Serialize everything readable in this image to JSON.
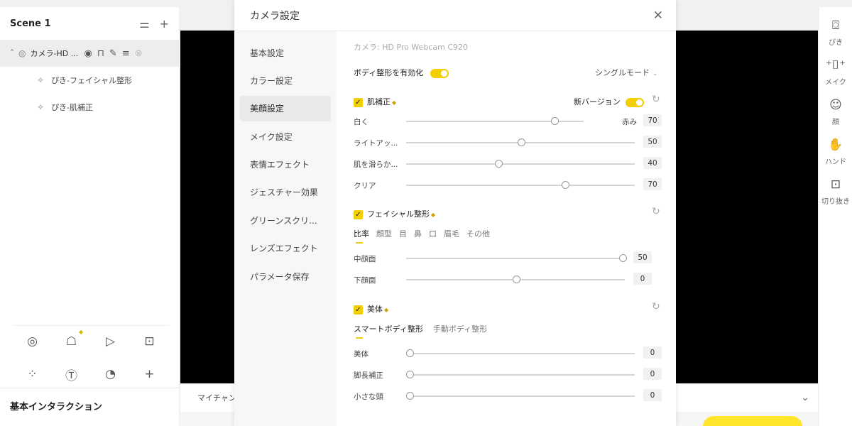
{
  "left": {
    "scene_title": "Scene 1",
    "source": {
      "name": "カメラ-HD ..."
    },
    "children": [
      "ぴき-フェイシャル整形",
      "ぴき-肌補正"
    ],
    "basic_interaction": "基本インタラクション"
  },
  "bottom_bar": {
    "label": "マイチャン"
  },
  "right_rail": [
    {
      "icon": "camera-frame-icon",
      "label": "ぴき"
    },
    {
      "icon": "makeup-icon",
      "label": "メイク"
    },
    {
      "icon": "face-icon",
      "label": "顔"
    },
    {
      "icon": "hand-icon",
      "label": "ハンド"
    },
    {
      "icon": "cutout-icon",
      "label": "切り抜き"
    }
  ],
  "modal": {
    "title": "カメラ設定",
    "nav": [
      "基本設定",
      "カラー設定",
      "美顔設定",
      "メイク設定",
      "表情エフェクト",
      "ジェスチャー効果",
      "グリーンスクリ...",
      "レンズエフェクト",
      "パラメータ保存"
    ],
    "active_nav": 2,
    "camera_label": "カメラ: HD Pro Webcam C920",
    "body_toggle_label": "ボディ整形を有効化",
    "mode_dropdown": "シングルモード",
    "skin": {
      "title": "肌補正",
      "new_version_label": "新バージョン",
      "sliders": [
        {
          "label": "白く",
          "value": 70,
          "right_label": "赤み"
        },
        {
          "label": "ライトアッ...",
          "value": 50
        },
        {
          "label": "肌を滑らか...",
          "value": 40
        },
        {
          "label": "クリア",
          "value": 70
        }
      ]
    },
    "facial": {
      "title": "フェイシャル整形",
      "tabs": [
        "比率",
        "顔型",
        "目",
        "鼻",
        "口",
        "眉毛",
        "その他"
      ],
      "sliders": [
        {
          "label": "中顔面",
          "value": 50
        },
        {
          "label": "下顔面",
          "value": 0
        }
      ]
    },
    "body": {
      "title": "美体",
      "tabs": [
        "スマートボディ整形",
        "手動ボディ整形"
      ],
      "sliders": [
        {
          "label": "美体",
          "value": 0
        },
        {
          "label": "脚長補正",
          "value": 0
        },
        {
          "label": "小さな頭",
          "value": 0
        }
      ]
    }
  }
}
